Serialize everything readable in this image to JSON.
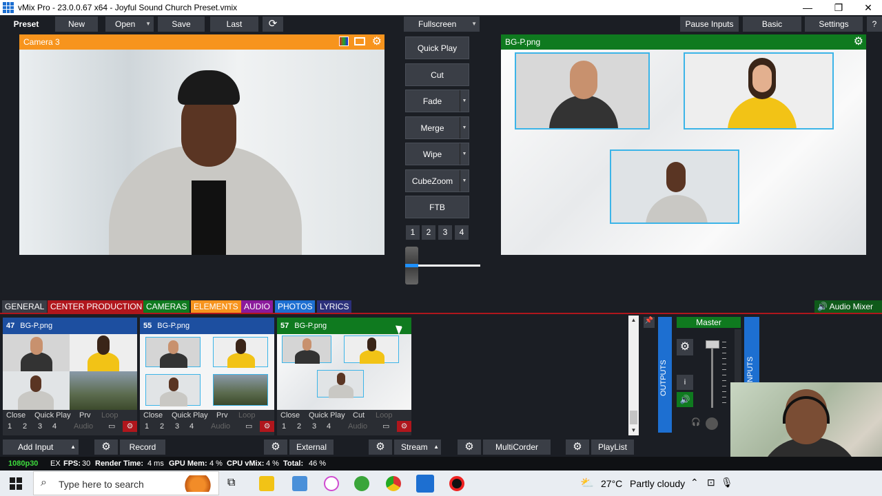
{
  "window": {
    "title": "vMix Pro - 23.0.0.67 x64 - Joyful Sound Church Preset.vmix",
    "minimize": "—",
    "maximize": "❐",
    "close": "✕"
  },
  "toolbar": {
    "preset": "Preset",
    "new": "New",
    "open": "Open",
    "save": "Save",
    "last": "Last",
    "fullscreen": "Fullscreen",
    "pause_inputs": "Pause Inputs",
    "basic": "Basic",
    "settings": "Settings",
    "help": "?"
  },
  "preview": {
    "title": "Camera 3",
    "color": "#f7941d"
  },
  "output": {
    "title": "BG-P.png",
    "color": "#0f7a1f"
  },
  "transitions": {
    "quick_play": "Quick Play",
    "cut": "Cut",
    "fade": "Fade",
    "merge": "Merge",
    "wipe": "Wipe",
    "cubezoom": "CubeZoom",
    "ftb": "FTB",
    "nums": [
      "1",
      "2",
      "3",
      "4"
    ]
  },
  "tabs": [
    {
      "label": "GENERAL",
      "color": "#3a3e46"
    },
    {
      "label": "CENTER PRODUCTION",
      "color": "#b0161c"
    },
    {
      "label": "CAMERAS",
      "color": "#0f7a1f"
    },
    {
      "label": "ELEMENTS",
      "color": "#f7941d"
    },
    {
      "label": "AUDIO",
      "color": "#8b1a9b"
    },
    {
      "label": "PHOTOS",
      "color": "#1d6fd1"
    },
    {
      "label": "LYRICS",
      "color": "#2b2f7a"
    }
  ],
  "audio_mixer": {
    "label": "Audio Mixer",
    "master": "Master",
    "outputs": "OUTPUTS",
    "inputs": "INPUTS",
    "info": "i"
  },
  "inputs": [
    {
      "num": "47",
      "name": "BG-P.png",
      "color": "#1d4fa0",
      "r1": [
        "Close",
        "Quick Play",
        "Prv",
        "Loop"
      ],
      "r2": [
        "1",
        "2",
        "3",
        "4",
        "Audio"
      ]
    },
    {
      "num": "55",
      "name": "BG-P.png",
      "color": "#1d4fa0",
      "r1": [
        "Close",
        "Quick Play",
        "Prv",
        "Loop"
      ],
      "r2": [
        "1",
        "2",
        "3",
        "4",
        "Audio"
      ]
    },
    {
      "num": "57",
      "name": "BG-P.png",
      "color": "#0f7a1f",
      "r1": [
        "Close",
        "Quick Play",
        "Cut",
        "Loop"
      ],
      "r2": [
        "1",
        "2",
        "3",
        "4",
        "Audio"
      ]
    }
  ],
  "bottom": {
    "add_input": "Add Input",
    "record": "Record",
    "external": "External",
    "stream": "Stream",
    "multicorder": "MultiCorder",
    "playlist": "PlayList"
  },
  "status": {
    "format": "1080p30",
    "ex": "EX",
    "fps_label": "FPS:",
    "fps": "30",
    "render_label": "Render Time:",
    "render": "4 ms",
    "gpu_label": "GPU Mem:",
    "gpu": "4 %",
    "cpu_label": "CPU vMix:",
    "cpu": "4 %",
    "total_label": "Total:",
    "total": "46 %"
  },
  "taskbar": {
    "search": "Type here to search",
    "temp": "27°C",
    "weather": "Partly cloudy"
  }
}
